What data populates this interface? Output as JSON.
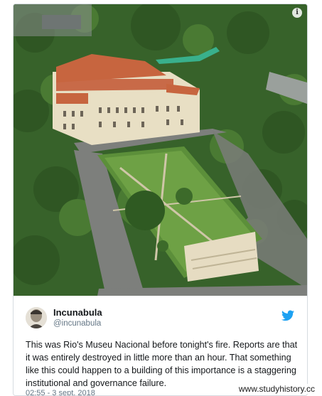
{
  "tweet": {
    "display_name": "Incunabula",
    "handle": "@incunabula",
    "text": "This was Rio's Museu Nacional before tonight's fire. Reports are that it was entirely destroyed in little more than an hour. That something like this could happen to a building of this importance is a staggering institutional and governance failure.",
    "timestamp": "02:55 - 3 sept. 2018"
  },
  "photo": {
    "info_icon": "info-icon",
    "info_glyph": "i"
  },
  "icons": {
    "brand": "twitter-bird-icon"
  },
  "colors": {
    "twitter_blue": "#1da1f2",
    "text": "#14171a",
    "muted": "#657786"
  },
  "watermark": "www.studyhistory.cc"
}
